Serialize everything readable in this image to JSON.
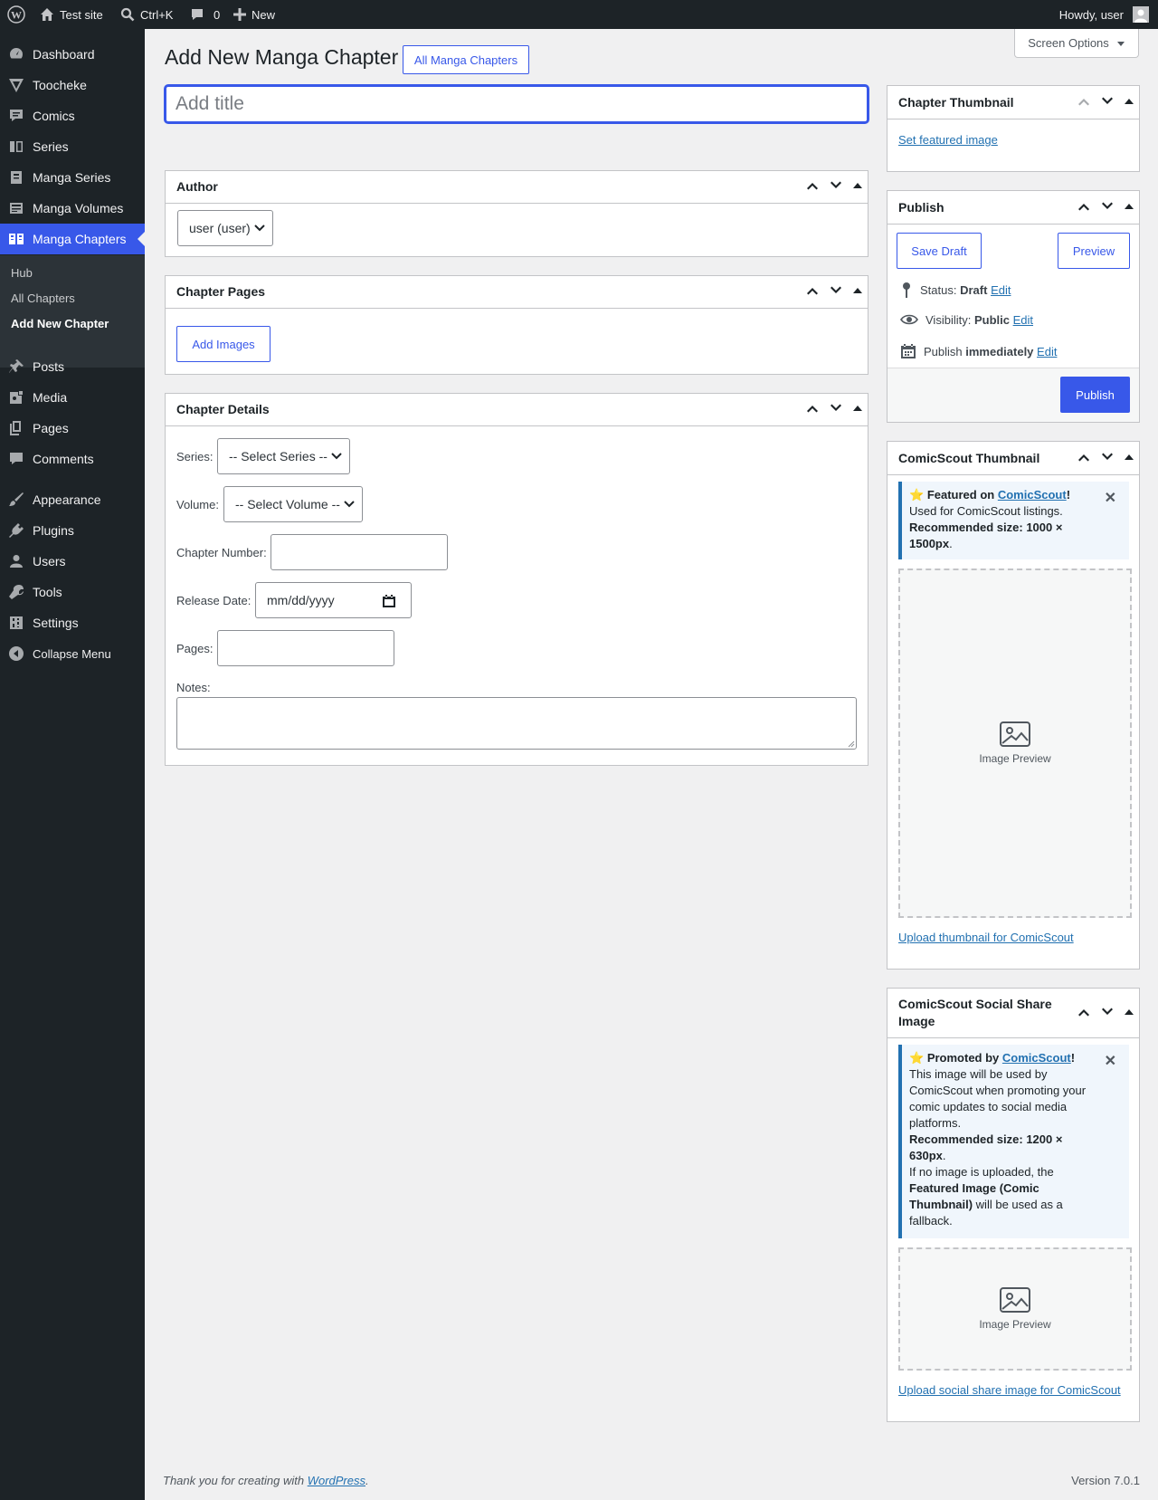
{
  "admin_bar": {
    "site_name": "Test site",
    "search_shortcut": "Ctrl+K",
    "comments_count": "0",
    "new_label": "New",
    "greeting": "Howdy, user"
  },
  "sidebar": {
    "items": [
      {
        "label": "Dashboard",
        "icon": "dashboard-icon"
      },
      {
        "label": "Toocheke",
        "icon": "toocheke-icon"
      },
      {
        "label": "Comics",
        "icon": "comics-icon"
      },
      {
        "label": "Series",
        "icon": "series-icon"
      },
      {
        "label": "Manga Series",
        "icon": "manga-series-icon"
      },
      {
        "label": "Manga Volumes",
        "icon": "manga-volumes-icon"
      },
      {
        "label": "Manga Chapters",
        "icon": "manga-chapters-icon"
      },
      {
        "label": "Posts",
        "icon": "posts-icon"
      },
      {
        "label": "Media",
        "icon": "media-icon"
      },
      {
        "label": "Pages",
        "icon": "pages-icon"
      },
      {
        "label": "Comments",
        "icon": "comments-icon"
      },
      {
        "label": "Appearance",
        "icon": "appearance-icon"
      },
      {
        "label": "Plugins",
        "icon": "plugins-icon"
      },
      {
        "label": "Users",
        "icon": "users-icon"
      },
      {
        "label": "Tools",
        "icon": "tools-icon"
      },
      {
        "label": "Settings",
        "icon": "settings-icon"
      },
      {
        "label": "Collapse Menu",
        "icon": "collapse-icon"
      }
    ],
    "submenu": [
      {
        "label": "Hub"
      },
      {
        "label": "All Chapters"
      },
      {
        "label": "Add New Chapter"
      }
    ]
  },
  "header": {
    "title": "Add New Manga Chapter",
    "all_button": "All Manga Chapters",
    "screen_options": "Screen Options"
  },
  "title_field": {
    "placeholder": "Add title",
    "value": ""
  },
  "author_box": {
    "title": "Author",
    "selected": "user (user)"
  },
  "pages_box": {
    "title": "Chapter Pages",
    "add_images": "Add Images"
  },
  "details_box": {
    "title": "Chapter Details",
    "series_label": "Series:",
    "series_selected": "-- Select Series --",
    "volume_label": "Volume:",
    "volume_selected": "-- Select Volume --",
    "chapter_number_label": "Chapter Number:",
    "release_date_label": "Release Date:",
    "release_date_placeholder": "mm/dd/yyyy",
    "pages_label": "Pages:",
    "notes_label": "Notes:"
  },
  "thumbnail_box": {
    "title": "Chapter Thumbnail",
    "link": "Set featured image"
  },
  "publish_box": {
    "title": "Publish",
    "save_draft": "Save Draft",
    "preview": "Preview",
    "status_label": "Status:",
    "status_value": "Draft",
    "visibility_label": "Visibility:",
    "visibility_value": "Public",
    "publish_label": "Publish",
    "publish_value": "immediately",
    "edit": "Edit",
    "publish_button": "Publish"
  },
  "comicscout_thumb": {
    "title": "ComicScout Thumbnail",
    "notice_prefix": "Featured on",
    "brand": "ComicScout",
    "notice_line": "Used for ComicScout listings.",
    "recommended": "Recommended size: 1000 × 1500px",
    "preview_label": "Image Preview",
    "upload_link": "Upload thumbnail for ComicScout"
  },
  "comicscout_social": {
    "title": "ComicScout Social Share Image",
    "notice_prefix": "Promoted by",
    "brand": "ComicScout",
    "notice_line": "This image will be used by ComicScout when promoting your comic updates to social media platforms.",
    "recommended": "Recommended size: 1200 × 630px",
    "fallback_a": "If no image is uploaded, the",
    "fallback_b": "Featured Image (Comic Thumbnail)",
    "fallback_c": "will be used as a fallback.",
    "preview_label": "Image Preview",
    "upload_link": "Upload social share image for ComicScout"
  },
  "footer": {
    "thanks": "Thank you for creating with",
    "wp_link": "WordPress",
    "version": "Version 7.0.1"
  },
  "colors": {
    "accent": "#3858e9",
    "sidebar_bg": "#1d2327",
    "link": "#2271b1"
  }
}
